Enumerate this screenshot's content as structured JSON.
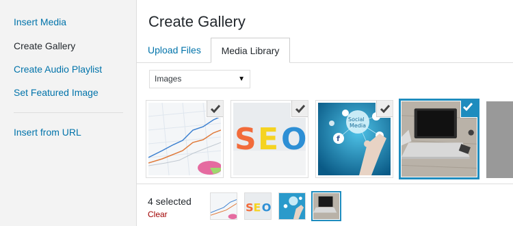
{
  "sidebar": {
    "items": [
      {
        "label": "Insert Media"
      },
      {
        "label": "Create Gallery"
      },
      {
        "label": "Create Audio Playlist"
      },
      {
        "label": "Set Featured Image"
      },
      {
        "label": "Insert from URL"
      }
    ]
  },
  "main": {
    "title": "Create Gallery",
    "tabs": [
      {
        "label": "Upload Files"
      },
      {
        "label": "Media Library"
      }
    ],
    "filter": {
      "selected": "Images"
    },
    "seo_text": "SEO",
    "social_text": "Social Media"
  },
  "selection": {
    "count_label": "4 selected",
    "clear_label": "Clear"
  },
  "colors": {
    "accent": "#1e8cbe",
    "link": "#0073aa",
    "clear": "#a00000"
  }
}
